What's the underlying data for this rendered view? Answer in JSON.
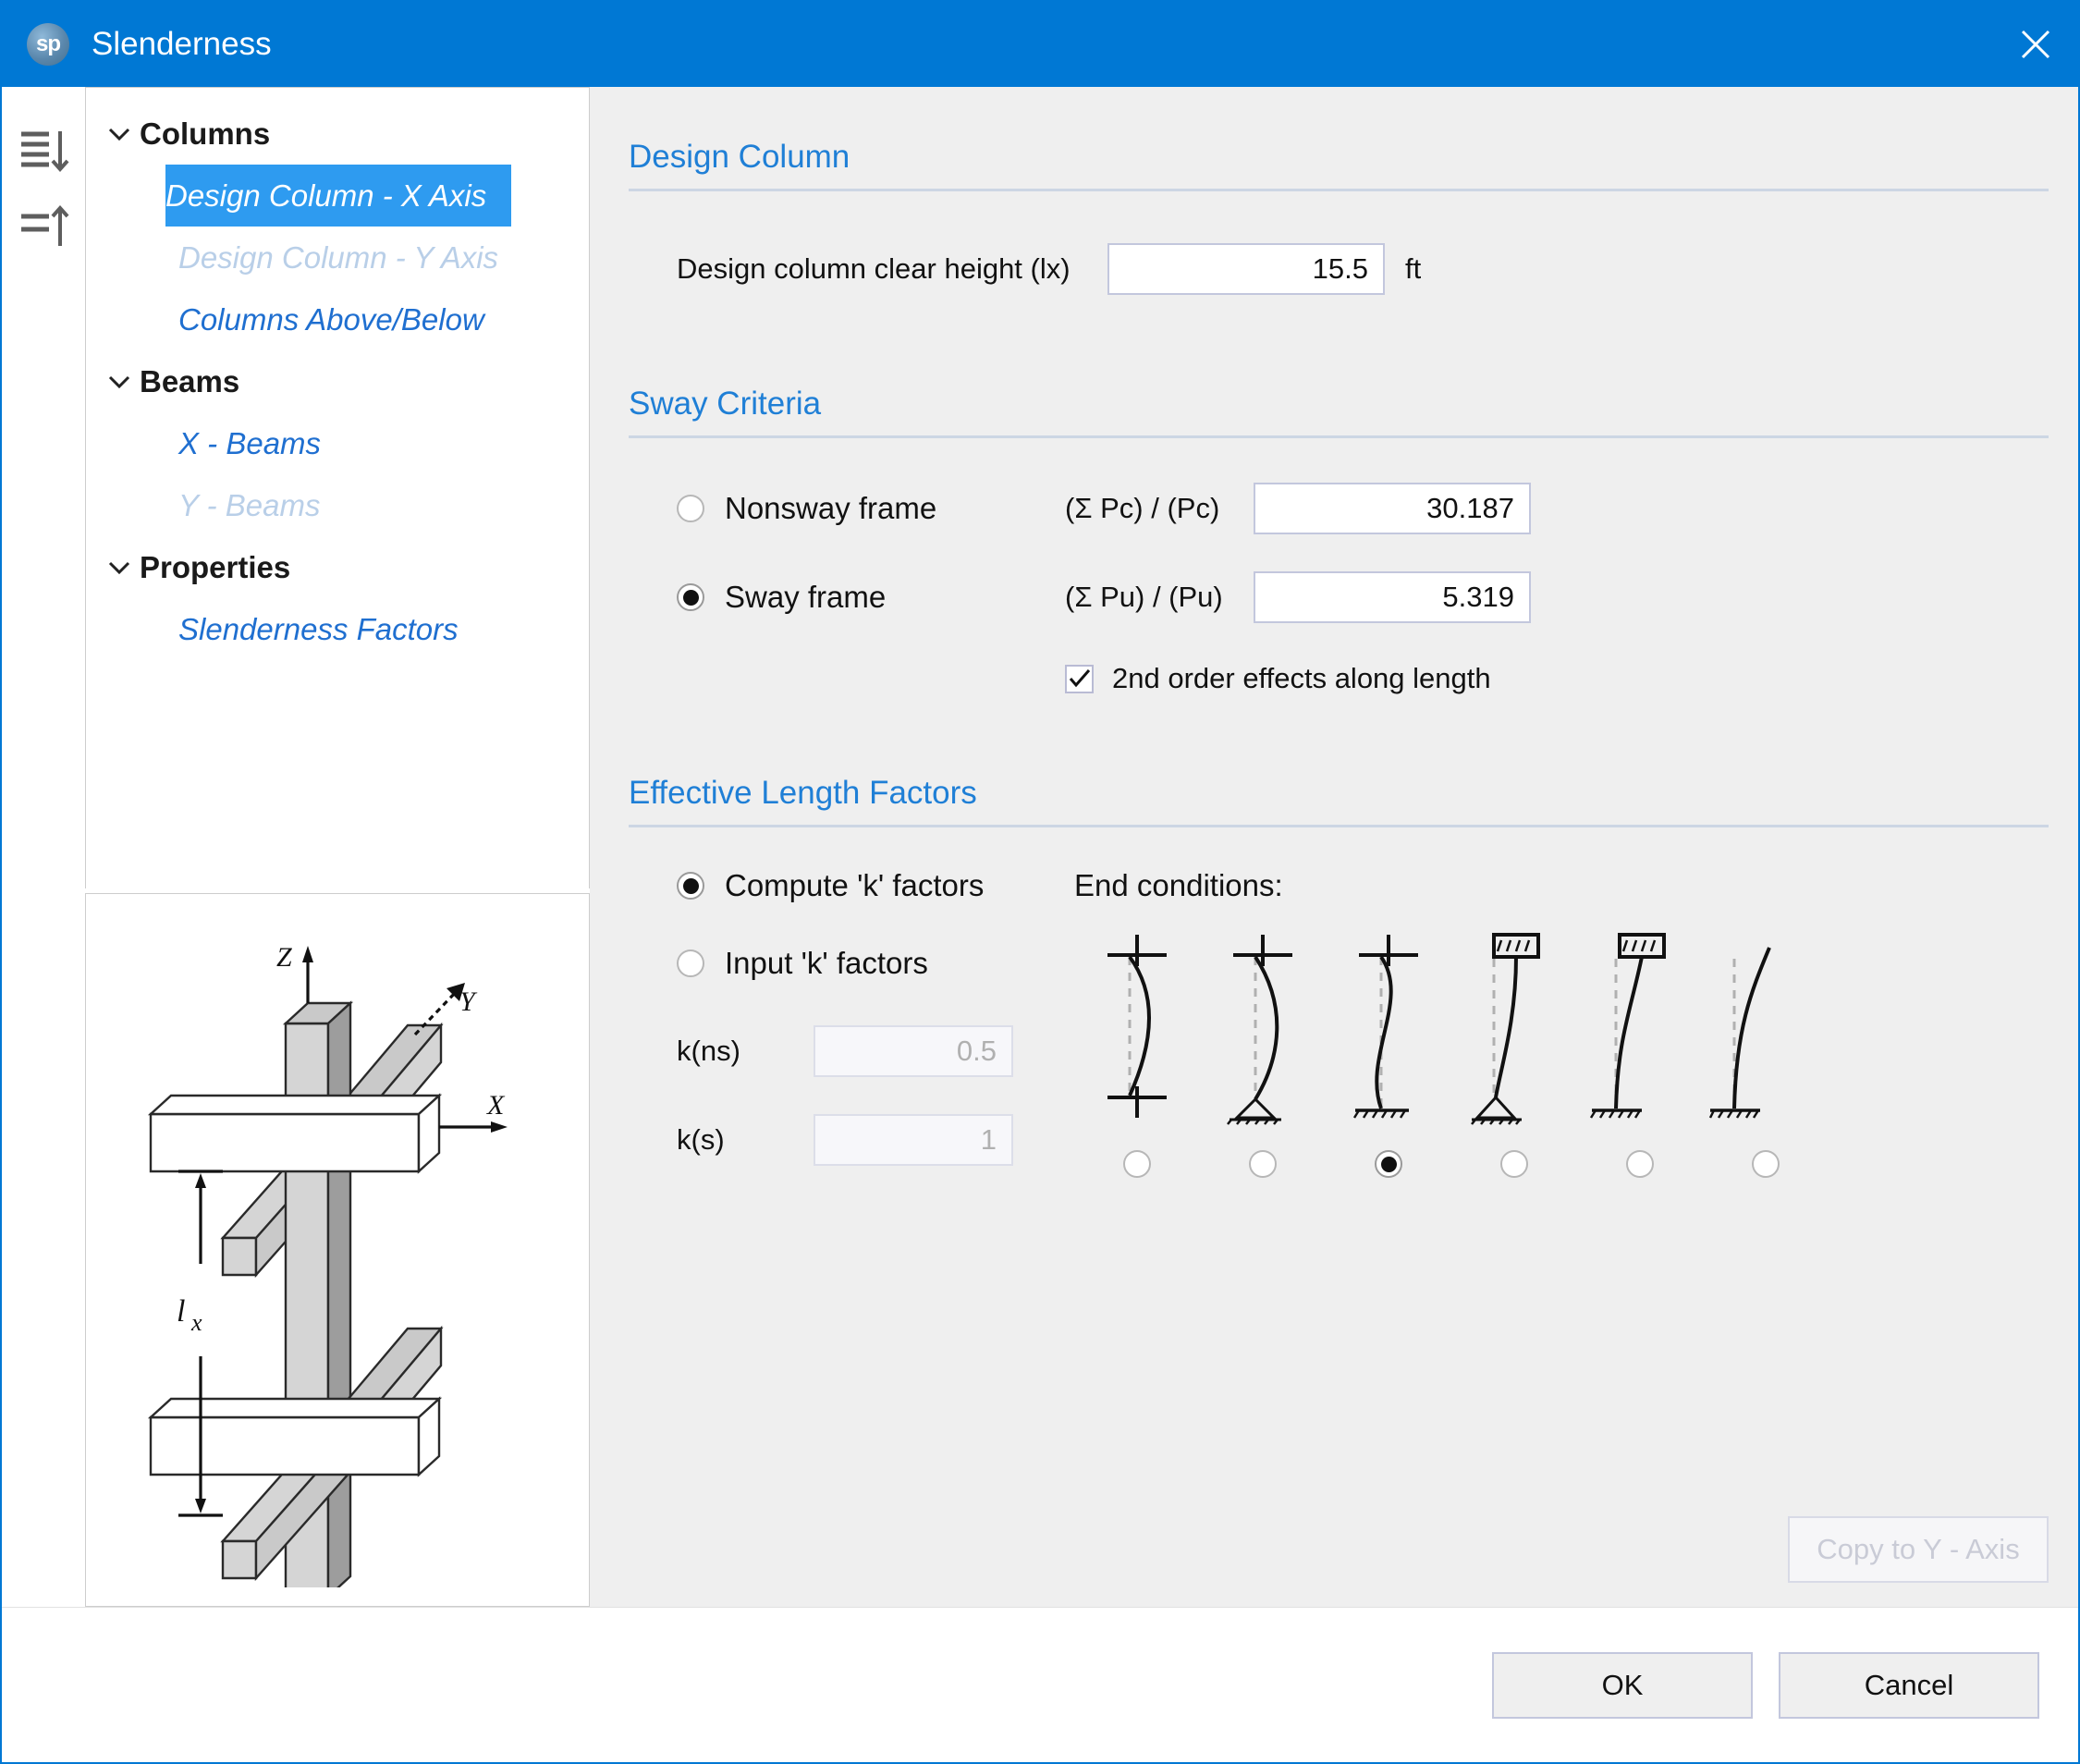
{
  "window": {
    "title": "Slenderness",
    "logo_text": "sp",
    "close_icon": "close-icon"
  },
  "rail": {
    "items": [
      {
        "icon": "expand-all-icon",
        "label": "Expand all"
      },
      {
        "icon": "collapse-all-icon",
        "label": "Collapse all"
      }
    ]
  },
  "tree": {
    "nodes": [
      {
        "label": "Columns",
        "type": "group",
        "expanded": true,
        "state": "normal"
      },
      {
        "label": "Design Column - X Axis",
        "type": "child",
        "state": "selected"
      },
      {
        "label": "Design Column - Y Axis",
        "type": "child",
        "state": "disabled"
      },
      {
        "label": "Columns Above/Below",
        "type": "child",
        "state": "normal"
      },
      {
        "label": "Beams",
        "type": "group",
        "expanded": true,
        "state": "normal"
      },
      {
        "label": "X - Beams",
        "type": "child",
        "state": "normal"
      },
      {
        "label": "Y - Beams",
        "type": "child",
        "state": "disabled"
      },
      {
        "label": "Properties",
        "type": "group",
        "expanded": true,
        "state": "normal"
      },
      {
        "label": "Slenderness Factors",
        "type": "child",
        "state": "normal"
      }
    ]
  },
  "preview": {
    "axis_z": "Z",
    "axis_y": "Y",
    "axis_x": "X",
    "dimension_label": "l",
    "dimension_sub": "x"
  },
  "design_column": {
    "title": "Design Column",
    "height_label": "Design column clear height (lx)",
    "height_value": "15.5",
    "height_unit": "ft"
  },
  "sway_criteria": {
    "title": "Sway Criteria",
    "nonsway_label": "Nonsway frame",
    "nonsway_selected": false,
    "sway_label": "Sway frame",
    "sway_selected": true,
    "pc_label": "(Σ Pc) / (Pc)",
    "pc_value": "30.187",
    "pu_label": "(Σ Pu) / (Pu)",
    "pu_value": "5.319",
    "second_order_label": "2nd order effects along length",
    "second_order_checked": true
  },
  "effective_length": {
    "title": "Effective Length Factors",
    "compute_label": "Compute 'k' factors",
    "compute_selected": true,
    "input_label": "Input 'k' factors",
    "input_selected": false,
    "kns_label": "k(ns)",
    "kns_value": "0.5",
    "kns_disabled": true,
    "ks_label": "k(s)",
    "ks_value": "1",
    "ks_disabled": true,
    "end_conditions_label": "End conditions:",
    "end_conditions": [
      {
        "id": "fixed-fixed",
        "selected": false
      },
      {
        "id": "fixed-pinned",
        "selected": false
      },
      {
        "id": "fixed-base",
        "selected": true
      },
      {
        "id": "slider-pinned",
        "selected": false
      },
      {
        "id": "slider-fixed",
        "selected": false
      },
      {
        "id": "free-fixed",
        "selected": false
      }
    ]
  },
  "actions": {
    "copy_label": "Copy to Y - Axis",
    "copy_disabled": true,
    "ok_label": "OK",
    "cancel_label": "Cancel"
  },
  "colors": {
    "accent": "#0078d4",
    "selection": "#2e9bf0",
    "section_title": "#1f7fd6",
    "link": "#1f6fd0",
    "panel_bg": "#efefef"
  }
}
